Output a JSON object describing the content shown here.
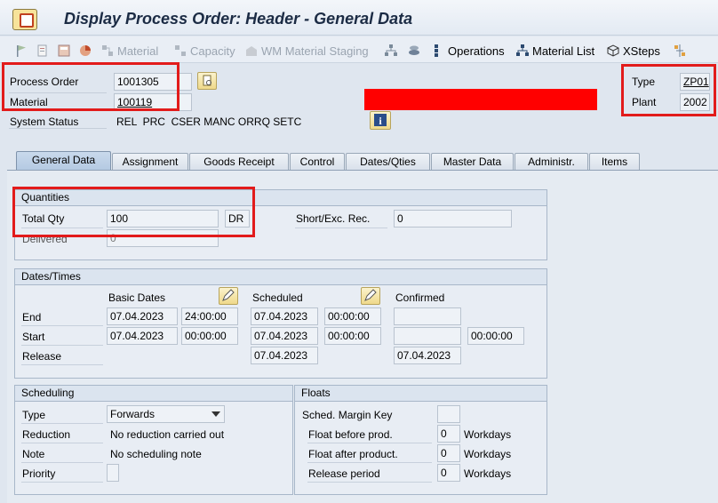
{
  "title": "Display Process Order: Header - General Data",
  "toolbar": {
    "material": "Material",
    "capacity": "Capacity",
    "wm_staging": "WM Material Staging",
    "operations": "Operations",
    "material_list": "Material List",
    "xsteps": "XSteps"
  },
  "header": {
    "process_order_label": "Process Order",
    "process_order_value": "1001305",
    "material_label": "Material",
    "material_value": "100119",
    "system_status_label": "System Status",
    "system_status_value": "REL  PRC  CSER MANC ORRQ SETC",
    "type_label": "Type",
    "type_value": "ZP01",
    "plant_label": "Plant",
    "plant_value": "2002"
  },
  "tabs": [
    "General Data",
    "Assignment",
    "Goods Receipt",
    "Control",
    "Dates/Qties",
    "Master Data",
    "Administr.",
    "Items"
  ],
  "quantities": {
    "title": "Quantities",
    "total_qty_label": "Total Qty",
    "total_qty_value": "100",
    "unit": "DR",
    "short_exc_label": "Short/Exc. Rec.",
    "short_exc_value": "0",
    "delivered_label": "Delivered",
    "delivered_value": "0"
  },
  "dates": {
    "title": "Dates/Times",
    "basic_dates": "Basic Dates",
    "scheduled": "Scheduled",
    "confirmed": "Confirmed",
    "end_label": "End",
    "start_label": "Start",
    "release_label": "Release",
    "end_basic_date": "07.04.2023",
    "end_basic_time": "24:00:00",
    "end_sched_date": "07.04.2023",
    "end_sched_time": "00:00:00",
    "start_basic_date": "07.04.2023",
    "start_basic_time": "00:00:00",
    "start_sched_date": "07.04.2023",
    "start_sched_time": "00:00:00",
    "start_conf_time": "00:00:00",
    "release_sched_date": "07.04.2023",
    "release_conf_date": "07.04.2023"
  },
  "scheduling": {
    "title": "Scheduling",
    "type_label": "Type",
    "type_value": "Forwards",
    "reduction_label": "Reduction",
    "reduction_value": "No reduction carried out",
    "note_label": "Note",
    "note_value": "No scheduling note",
    "priority_label": "Priority"
  },
  "floats": {
    "title": "Floats",
    "margin_key_label": "Sched. Margin Key",
    "float_before_label": "Float before prod.",
    "float_before_value": "0",
    "float_after_label": "Float after product.",
    "float_after_value": "0",
    "release_period_label": "Release period",
    "release_period_value": "0",
    "unit": "Workdays"
  }
}
